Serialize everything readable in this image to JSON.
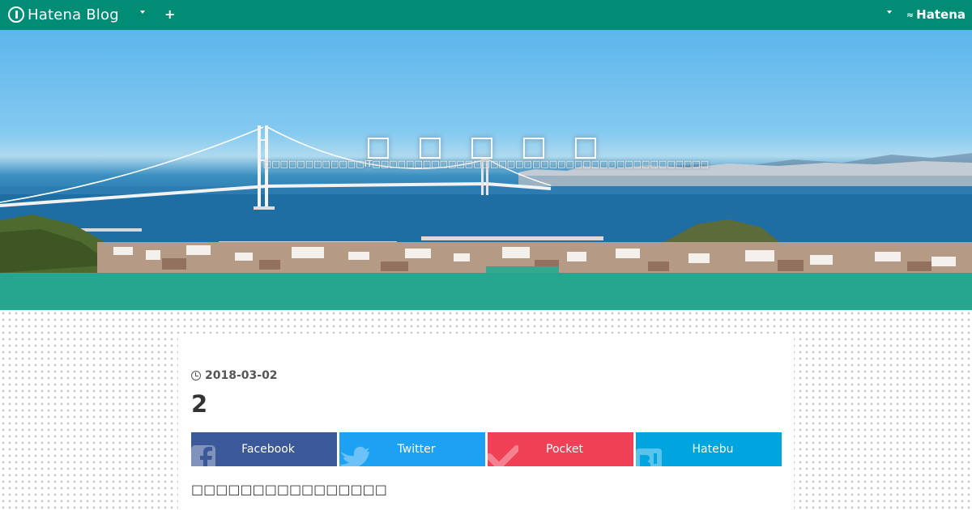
{
  "topbar": {
    "brand_name": "Hatena Blog",
    "plus_symbol": "+",
    "hatena_label": "Hatena",
    "bar_color": "#008c75"
  },
  "hero": {
    "blog_title": "□ □ □ □ □",
    "blog_description": "□□□□□□□□□□□□IT□□□□□□□□□□□□□□□□□□□□□□□□□□□□□□□□□□□□□□□□"
  },
  "article": {
    "date": "2018-03-02",
    "title": "2",
    "body": "□□□□□□□□□□□□□□□□"
  },
  "share": [
    {
      "label": "Facebook",
      "color": "#3b5998",
      "icon": "facebook-icon"
    },
    {
      "label": "Twitter",
      "color": "#1da1f2",
      "icon": "twitter-icon"
    },
    {
      "label": "Pocket",
      "color": "#ef4056",
      "icon": "pocket-icon"
    },
    {
      "label": "Hatebu",
      "color": "#00a4de",
      "icon": "hatebu-icon"
    }
  ],
  "colors": {
    "band": "#26a58f",
    "text": "#333333"
  }
}
